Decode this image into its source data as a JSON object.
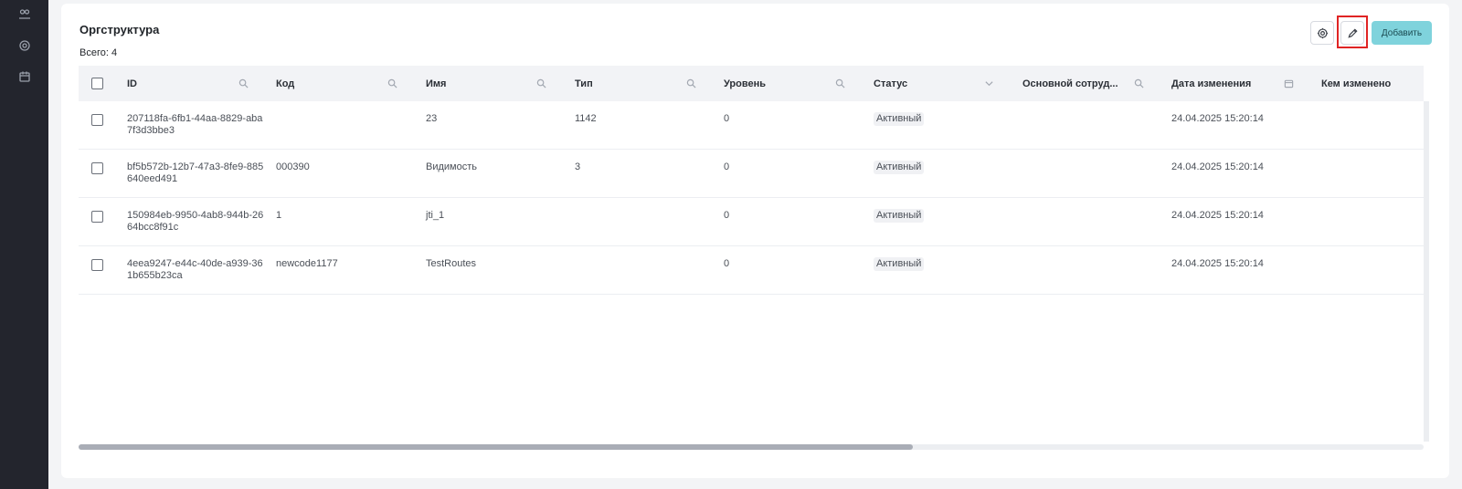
{
  "page": {
    "title": "Оргструктура",
    "count_label": "Всего: 4"
  },
  "toolbar": {
    "settings_icon": "gear-icon",
    "edit_icon": "pencil-icon",
    "add_label": "Добавить"
  },
  "columns": [
    {
      "label": "ID",
      "icon": "search-icon"
    },
    {
      "label": "Код",
      "icon": "search-icon"
    },
    {
      "label": "Имя",
      "icon": "search-icon"
    },
    {
      "label": "Тип",
      "icon": "search-icon"
    },
    {
      "label": "Уровень",
      "icon": "search-icon"
    },
    {
      "label": "Статус",
      "icon": "chevron-down-icon"
    },
    {
      "label": "Основной сотруд...",
      "icon": "search-icon"
    },
    {
      "label": "Дата изменения",
      "icon": "calendar-icon"
    },
    {
      "label": "Кем изменено",
      "icon": ""
    }
  ],
  "rows": [
    {
      "id": "207118fa-6fb1-44aa-8829-aba7f3d3bbe3",
      "code": "",
      "name": "23",
      "type": "1142",
      "level": "0",
      "status": "Активный",
      "employee": "",
      "changed": "24.04.2025 15:20:14",
      "changed_by": ""
    },
    {
      "id": "bf5b572b-12b7-47a3-8fe9-885640eed491",
      "code": "000390",
      "name": "Видимость",
      "type": "3",
      "level": "0",
      "status": "Активный",
      "employee": "",
      "changed": "24.04.2025 15:20:14",
      "changed_by": ""
    },
    {
      "id": "150984eb-9950-4ab8-944b-2664bcc8f91c",
      "code": "1",
      "name": "jti_1",
      "type": "",
      "level": "0",
      "status": "Активный",
      "employee": "",
      "changed": "24.04.2025 15:20:14",
      "changed_by": ""
    },
    {
      "id": "4eea9247-e44c-40de-a939-361b655b23ca",
      "code": "newcode1177",
      "name": "TestRoutes",
      "type": "",
      "level": "0",
      "status": "Активный",
      "employee": "",
      "changed": "24.04.2025 15:20:14",
      "changed_by": ""
    }
  ],
  "sidebar": {
    "items": [
      {
        "icon": "users-icon"
      },
      {
        "icon": "gear-icon"
      },
      {
        "icon": "calendar-icon"
      }
    ]
  },
  "scroll": {
    "horizontal_visible_fraction": 0.62
  }
}
